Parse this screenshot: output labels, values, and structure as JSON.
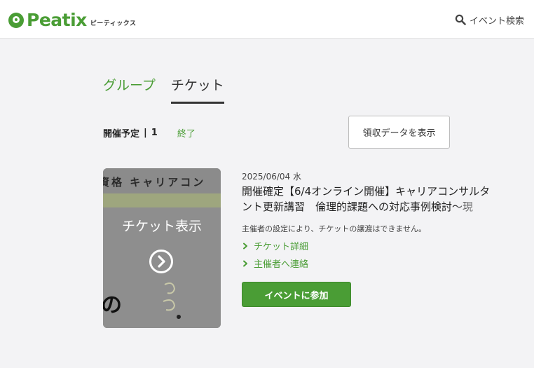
{
  "header": {
    "logo_text": "Peatix",
    "logo_sub": "ピーティックス",
    "search_label": "イベント検索",
    "accent": "#4a9d35"
  },
  "tabs": [
    {
      "label": "グループ",
      "active": false
    },
    {
      "label": "チケット",
      "active": true
    }
  ],
  "filter": {
    "upcoming_label": "開催予定",
    "separator": "|",
    "upcoming_count": "1",
    "ended_label": "終了"
  },
  "receipt_button": "領収データを表示",
  "ticket": {
    "thumb_heading": "資格 キャリアコン",
    "thumb_text": "の",
    "thumb_overlay_label": "チケット表示",
    "date": "2025/06/04 水",
    "title": "開催確定【6/4オンライン開催】キャリアコンサルタント更新講習　倫理的課題への対応事例検討～現",
    "note": "主催者の設定により、チケットの譲渡はできません。",
    "detail_link": "チケット詳細",
    "contact_link": "主催者へ連絡",
    "join_button": "イベントに参加"
  },
  "icons": {
    "search": "search-icon",
    "arrow": "chevron-right-circle-icon",
    "chevron": "chevron-right-icon"
  }
}
